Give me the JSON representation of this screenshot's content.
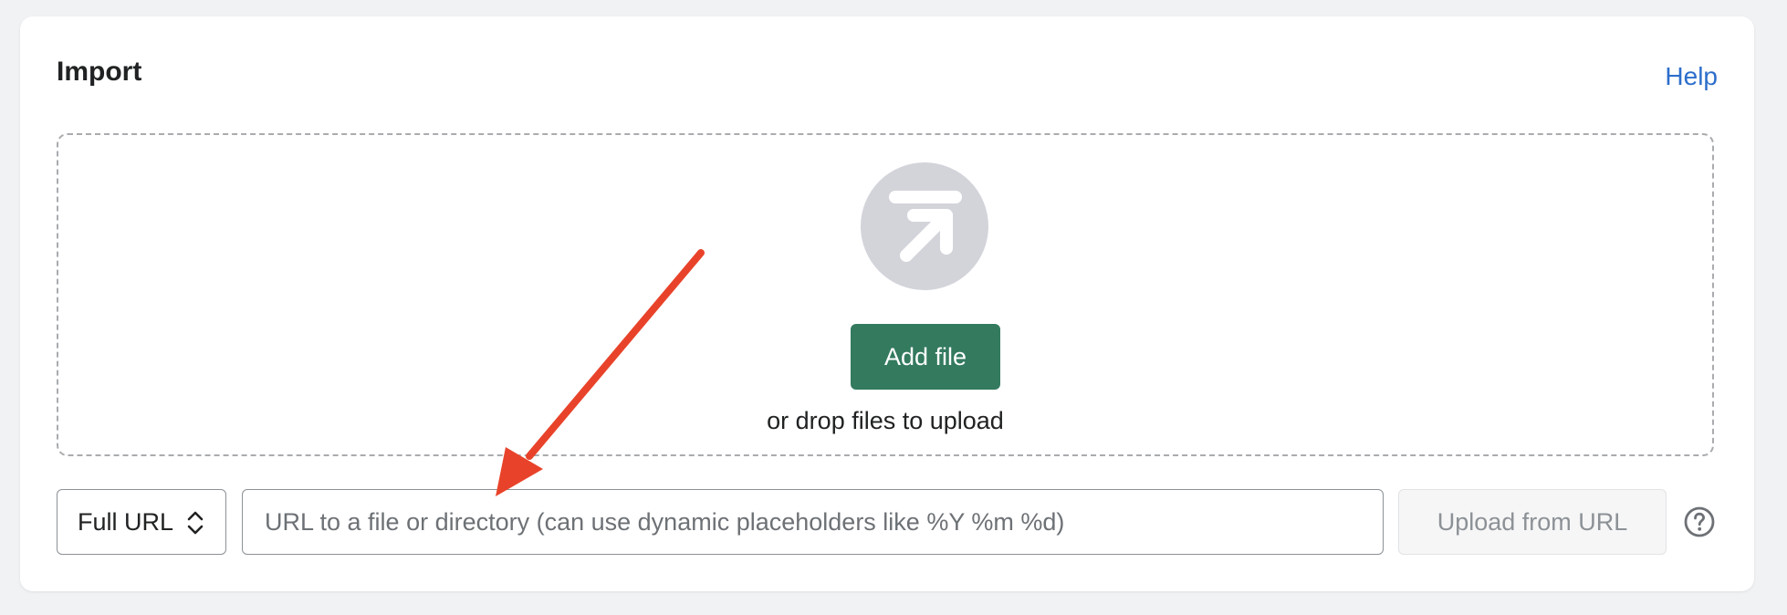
{
  "import": {
    "title": "Import",
    "help_label": "Help"
  },
  "dropzone": {
    "icon": "upload-arrow-icon",
    "add_file_label": "Add file",
    "drop_text": "or drop files to upload"
  },
  "url_row": {
    "mode_label": "Full URL",
    "url_placeholder": "URL to a file or directory (can use dynamic placeholders like %Y %m %d)",
    "upload_button_label": "Upload from URL",
    "help_icon": "question-circle-icon"
  },
  "colors": {
    "primary": "#337a5f",
    "link": "#2c6ecb",
    "annotation_arrow": "#e8432a"
  }
}
